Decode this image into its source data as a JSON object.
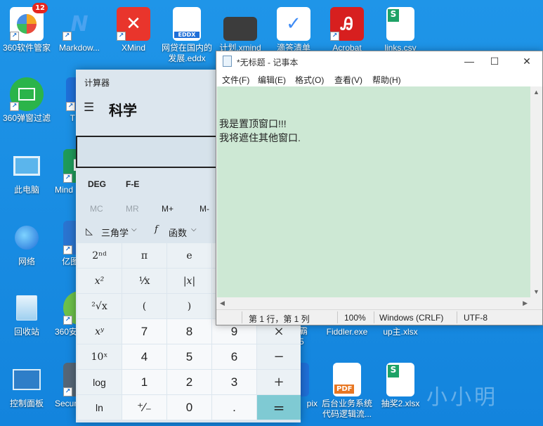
{
  "desktop_icons": [
    {
      "label": "360软件管家",
      "color": "#ef4b3a",
      "icon": "360-software-manager-icon",
      "badge": "12"
    },
    {
      "label": "Markdow...",
      "color": "#2d8ae6",
      "icon": "markdown-icon"
    },
    {
      "label": "XMind",
      "color": "#e9352c",
      "icon": "xmind-icon"
    },
    {
      "label": "网贷在国内的",
      "label2": "发展.eddx",
      "color": "#ffffff",
      "icon": "eddx-file-icon",
      "mark": "EDDX"
    },
    {
      "label": "计划.xmind",
      "color": "#3c3c3c",
      "icon": "xmind-file-icon"
    },
    {
      "label": "滴答清单",
      "color": "#ffffff",
      "icon": "ticktick-icon"
    },
    {
      "label": "Acrobat",
      "color": "#d71f1f",
      "icon": "acrobat-icon"
    },
    {
      "label": "links.csv",
      "color": "#ffffff",
      "icon": "csv-file-icon",
      "mark": "S"
    },
    {
      "label": "360弹窗过滤",
      "color": "#2bb44a",
      "icon": "popup-filter-icon"
    },
    {
      "label": "T",
      "color": "#1f6fd8",
      "icon": "app-icon-t"
    },
    {
      "label": "此电脑",
      "color": "#5bb5ec",
      "icon": "this-pc-icon"
    },
    {
      "label": "Mind",
      "color": "#1f9a5a",
      "icon": "mindmaster-icon"
    },
    {
      "label": "网络",
      "color": "#3f9ad8",
      "icon": "network-icon"
    },
    {
      "label": "亿图",
      "color": "#2a74d0",
      "icon": "edraw-icon"
    },
    {
      "label": "回收站",
      "color": "#9fd0f0",
      "icon": "recycle-bin-icon"
    },
    {
      "label": "360安",
      "color": "#6cc04a",
      "icon": "360-safe-icon"
    },
    {
      "label": "控制面板",
      "color": "#2e7ec8",
      "icon": "control-panel-icon"
    },
    {
      "label": "Secur",
      "color": "#556677",
      "icon": "security-icon"
    },
    {
      "label": "霸",
      "label2": "5",
      "color": "#1f6fd8",
      "icon": "app-icon-ba"
    },
    {
      "label": "Fiddler.exe",
      "color": "#1f6fd8",
      "icon": "fiddler-icon"
    },
    {
      "label": "up主.xlsx",
      "color": "#1f6fd8",
      "icon": "xlsx-file-icon"
    },
    {
      "label": "pix",
      "color": "#1f6fd8",
      "icon": "app-icon-pix"
    },
    {
      "label": "后台业务系统",
      "label2": "代码逻辑流...",
      "color": "#ffffff",
      "icon": "pdf-file-icon",
      "mark": "PDF"
    },
    {
      "label": "抽奖2.xlsx",
      "color": "#ffffff",
      "icon": "xlsx-file-icon-2",
      "mark": "S"
    }
  ],
  "calculator": {
    "title": "计算器",
    "mode": "科学",
    "angle_keys": [
      "DEG",
      "F-E"
    ],
    "memory_keys": [
      "MC",
      "MR",
      "M+",
      "M-"
    ],
    "trig_label": "三角学",
    "func_label": "函数",
    "keys": [
      [
        "2ⁿᵈ",
        "π",
        "e"
      ],
      [
        "x²",
        "¹⁄x",
        "|x|"
      ],
      [
        "²√x",
        "(",
        ")"
      ],
      [
        "xʸ",
        "7",
        "8",
        "9",
        "×"
      ],
      [
        "10ˣ",
        "4",
        "5",
        "6",
        "−"
      ],
      [
        "log",
        "1",
        "2",
        "3",
        "+"
      ],
      [
        "ln",
        "⁺∕₋",
        "0",
        ".",
        "="
      ]
    ]
  },
  "notepad": {
    "title": "*无标题 - 记事本",
    "menu": [
      "文件(F)",
      "编辑(E)",
      "格式(O)",
      "查看(V)",
      "帮助(H)"
    ],
    "lines": [
      "我是置顶窗口!!!",
      "我将遮住其他窗口."
    ],
    "status": {
      "position": "第 1 行，第 1 列",
      "zoom": "100%",
      "eol": "Windows (CRLF)",
      "encoding": "UTF-8"
    },
    "bg_color": "#cde8d4"
  },
  "watermark": "小小明"
}
